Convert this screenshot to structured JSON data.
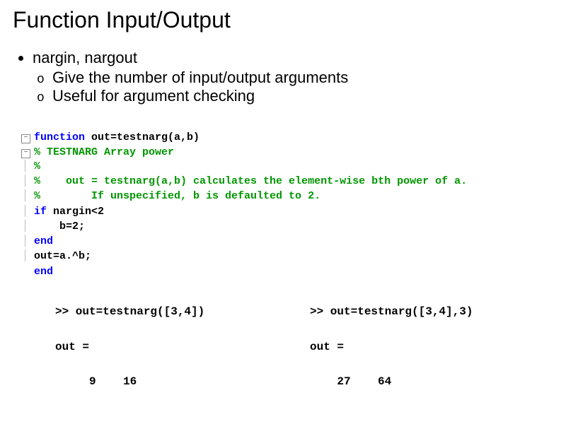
{
  "title": "Function Input/Output",
  "bullets": {
    "main": "nargin, nargout",
    "sub1": "Give the number of input/output arguments",
    "sub2": "Useful for argument checking"
  },
  "code": {
    "l1_kw": "function",
    "l1_rest": " out=testnarg(a,b)",
    "l2": "% TESTNARG Array power",
    "l3": "%",
    "l4": "%    out = testnarg(a,b) calculates the element-wise bth power of a.",
    "l5": "%        If unspecified, b is defaulted to 2.",
    "l6_kw": "if",
    "l6_rest": " nargin<2",
    "l7": "    b=2;",
    "l8": "end",
    "l9": "out=a.^b;",
    "l10": "end"
  },
  "repl_left": {
    "in": ">> out=testnarg([3,4])",
    "outlbl": "out =",
    "vals": "     9    16"
  },
  "repl_right": {
    "in": ">> out=testnarg([3,4],3)",
    "outlbl": "out =",
    "vals": "    27    64"
  }
}
